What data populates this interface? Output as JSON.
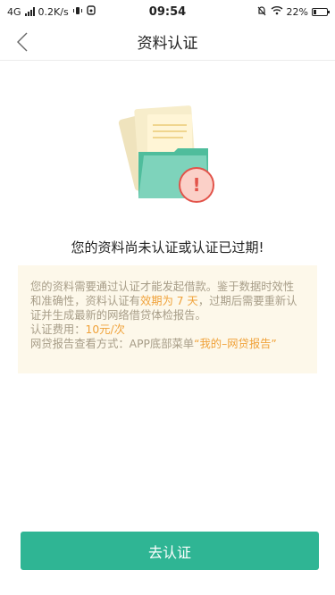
{
  "status_bar": {
    "network": "4G",
    "speed": "0.2K/s",
    "time": "09:54",
    "battery": "22%",
    "battery_level": 0.22,
    "icons": [
      "signal-icon",
      "vibrate-icon",
      "notification-icon",
      "alarm-off-icon",
      "wifi-icon",
      "battery-icon"
    ]
  },
  "nav": {
    "title": "资料认证",
    "back_icon": "chevron-left-icon"
  },
  "illustration": {
    "icons": [
      "document-folder-icon",
      "warning-badge-icon"
    ],
    "warning_glyph": "!"
  },
  "headline": "您的资料尚未认证或认证已过期!",
  "notice": {
    "line1_a": "您的资料需要通过认证才能发起借款。鉴于数据时效性和准确性，资料认证有",
    "line1_hl": "效期为 7 天",
    "line1_b": "，过期后需要重新认证并生成最新的网络借贷体检报告。",
    "fee_label": "认证费用：",
    "fee_value": "10元/次",
    "report_label": "网贷报告查看方式：APP底部菜单",
    "report_path": "“我的–网贷报告”"
  },
  "cta_label": "去认证",
  "colors": {
    "accent": "#2fb594",
    "highlight": "#f0a23a",
    "notice_bg": "#fdf8ea",
    "warning": "#e2534a"
  }
}
